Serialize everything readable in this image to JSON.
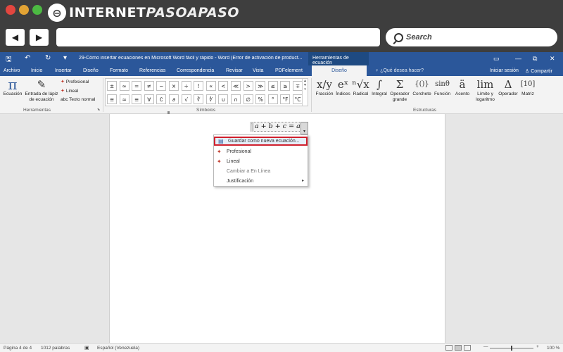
{
  "site": {
    "logo_symbol": "⊖",
    "logo_brand": "INTERNET",
    "logo_accent": "PASOAPASO"
  },
  "browser": {
    "back": "◀",
    "forward": "▶",
    "search_label": "Search"
  },
  "titlebar": {
    "save": "🖫",
    "undo": "↶",
    "redo": "↻",
    "customize": "▾",
    "doc_title": "29-Cómo insertar ecuaciones en Microsoft Word fácil y rápido - Word (Error de activación de product...",
    "context_group": "Herramientas de ecuación",
    "ribbon_display": "▭",
    "minimize": "—",
    "maximize": "⧉",
    "close": "✕"
  },
  "tabs": [
    "Archivo",
    "Inicio",
    "Insertar",
    "Diseño",
    "Formato",
    "Referencias",
    "Correspondencia",
    "Revisar",
    "Vista",
    "PDFelement"
  ],
  "active_tab": "Diseño",
  "tell_me": "♀ ¿Qué desea hacer?",
  "sign_in": "Iniciar sesión",
  "share": "♙ Compartir",
  "ribbon": {
    "group_herramientas": "Herramientas",
    "group_simbolos": "Símbolos",
    "group_estructuras": "Estructuras",
    "ecuacion": {
      "icon": "π",
      "label": "Ecuación"
    },
    "entrada": {
      "icon": "✎",
      "label": "Entrada de lápiz de ecuación"
    },
    "profesional": "Profesional",
    "lineal": "Lineal",
    "texto_normal": "abc Texto normal",
    "symbols_row1": [
      "±",
      "∞",
      "=",
      "≠",
      "~",
      "×",
      "÷",
      "!",
      "∝",
      "<",
      "≪",
      ">",
      "≫",
      "≤",
      "≥",
      "∓"
    ],
    "symbols_row2": [
      "≅",
      "≈",
      "≡",
      "∀",
      "∁",
      "∂",
      "√",
      "∛",
      "∜",
      "∪",
      "∩",
      "∅",
      "%",
      "°",
      "°F",
      "°C"
    ],
    "structures": [
      {
        "icon": "x/y",
        "label": "Fracción"
      },
      {
        "icon": "eˣ",
        "label": "Índices"
      },
      {
        "icon": "ⁿ√x",
        "label": "Radical"
      },
      {
        "icon": "∫",
        "label": "Integral"
      },
      {
        "icon": "Σ",
        "label": "Operador grande"
      },
      {
        "icon": "{()}",
        "label": "Corchete"
      },
      {
        "icon": "sinθ",
        "label": "Función"
      },
      {
        "icon": "ä",
        "label": "Acento"
      },
      {
        "icon": "lim",
        "label": "Límite y logaritmo"
      },
      {
        "icon": "Δ",
        "label": "Operador"
      },
      {
        "icon": "[10]",
        "label": "Matriz"
      }
    ]
  },
  "equation": {
    "text": "a + b + c = abc",
    "handle": "⋮",
    "dropdown": "▾"
  },
  "context_menu": [
    {
      "icon": "▤",
      "label": "Guardar como nueva ecuación..."
    },
    {
      "icon": "✦",
      "label": "Profesional"
    },
    {
      "icon": "✦",
      "label": "Lineal"
    },
    {
      "icon": "",
      "label": "Cambiar a En Línea"
    },
    {
      "icon": "",
      "label": "Justificación",
      "arrow": "▸"
    }
  ],
  "status": {
    "page": "Página 4 de 4",
    "words": "1012 palabras",
    "language": "Español (Venezuela)",
    "zoom": "100 %",
    "minus": "—",
    "plus": "+"
  },
  "colors": {
    "word_blue": "#2b579a",
    "highlight_red": "#d0202e"
  }
}
